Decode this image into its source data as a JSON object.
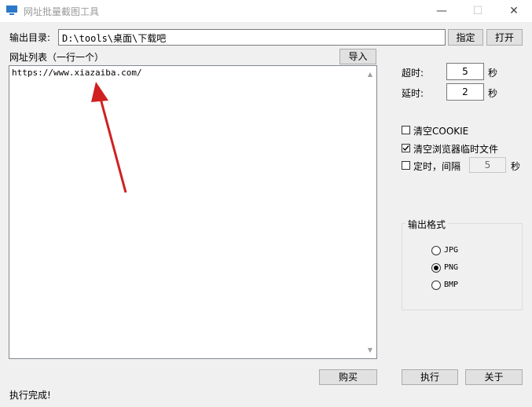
{
  "window": {
    "title": "网址批量截图工具",
    "min": "—",
    "max": "☐",
    "close": "✕"
  },
  "output_dir": {
    "label": "输出目录:",
    "value": "D:\\tools\\桌面\\下载吧",
    "assign_button": "指定",
    "open_button": "打开"
  },
  "url_list": {
    "label": "网址列表（一行一个）",
    "import_button": "导入",
    "content": "https://www.xiazaiba.com/"
  },
  "settings": {
    "timeout_label": "超时:",
    "timeout_value": "5",
    "timeout_unit": "秒",
    "delay_label": "延时:",
    "delay_value": "2",
    "delay_unit": "秒",
    "clear_cookie_label": "清空COOKIE",
    "clear_cookie_checked": false,
    "clear_temp_label": "清空浏览器临时文件",
    "clear_temp_checked": true,
    "timer_label": "定时，间隔",
    "timer_checked": false,
    "timer_value": "5",
    "timer_unit": "秒"
  },
  "format": {
    "title": "输出格式",
    "options": [
      "JPG",
      "PNG",
      "BMP"
    ],
    "selected": "PNG"
  },
  "footer": {
    "buy_button": "购买",
    "run_button": "执行",
    "about_button": "关于",
    "status": "执行完成!"
  },
  "colors": {
    "accent_arrow": "#d02020",
    "title_icon": "#2b78c9"
  }
}
